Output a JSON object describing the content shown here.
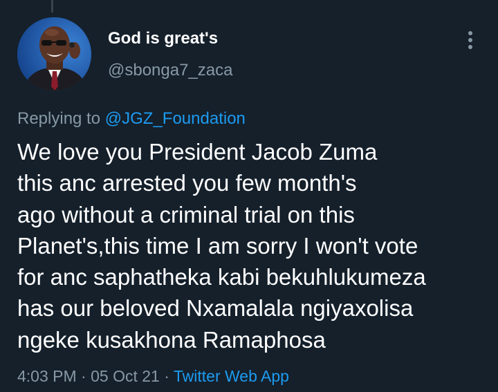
{
  "author": {
    "display_name": "God is great's",
    "handle": "@sbonga7_zaca",
    "avatar_icon": "profile-photo"
  },
  "more_icon": "vertical-ellipsis-icon",
  "reply": {
    "prefix": "Replying to",
    "mention": "@JGZ_Foundation"
  },
  "tweet": {
    "lines": [
      "We love you President Jacob Zuma",
      "this anc arrested you few month's",
      "ago without a criminal trial on this",
      "Planet's,this time I am sorry I won't vote",
      "for anc saphatheka kabi bekuhlukumeza",
      "has our beloved Nxamalala ngiyaxolisa",
      "ngeke kusakhona Ramaphosa"
    ]
  },
  "meta": {
    "time": "4:03 PM",
    "date": "05 Oct 21",
    "separator": "·",
    "source": "Twitter Web App"
  },
  "colors": {
    "background": "#15202b",
    "text": "#ffffff",
    "muted": "#8899a6",
    "link": "#1d9bf0"
  }
}
